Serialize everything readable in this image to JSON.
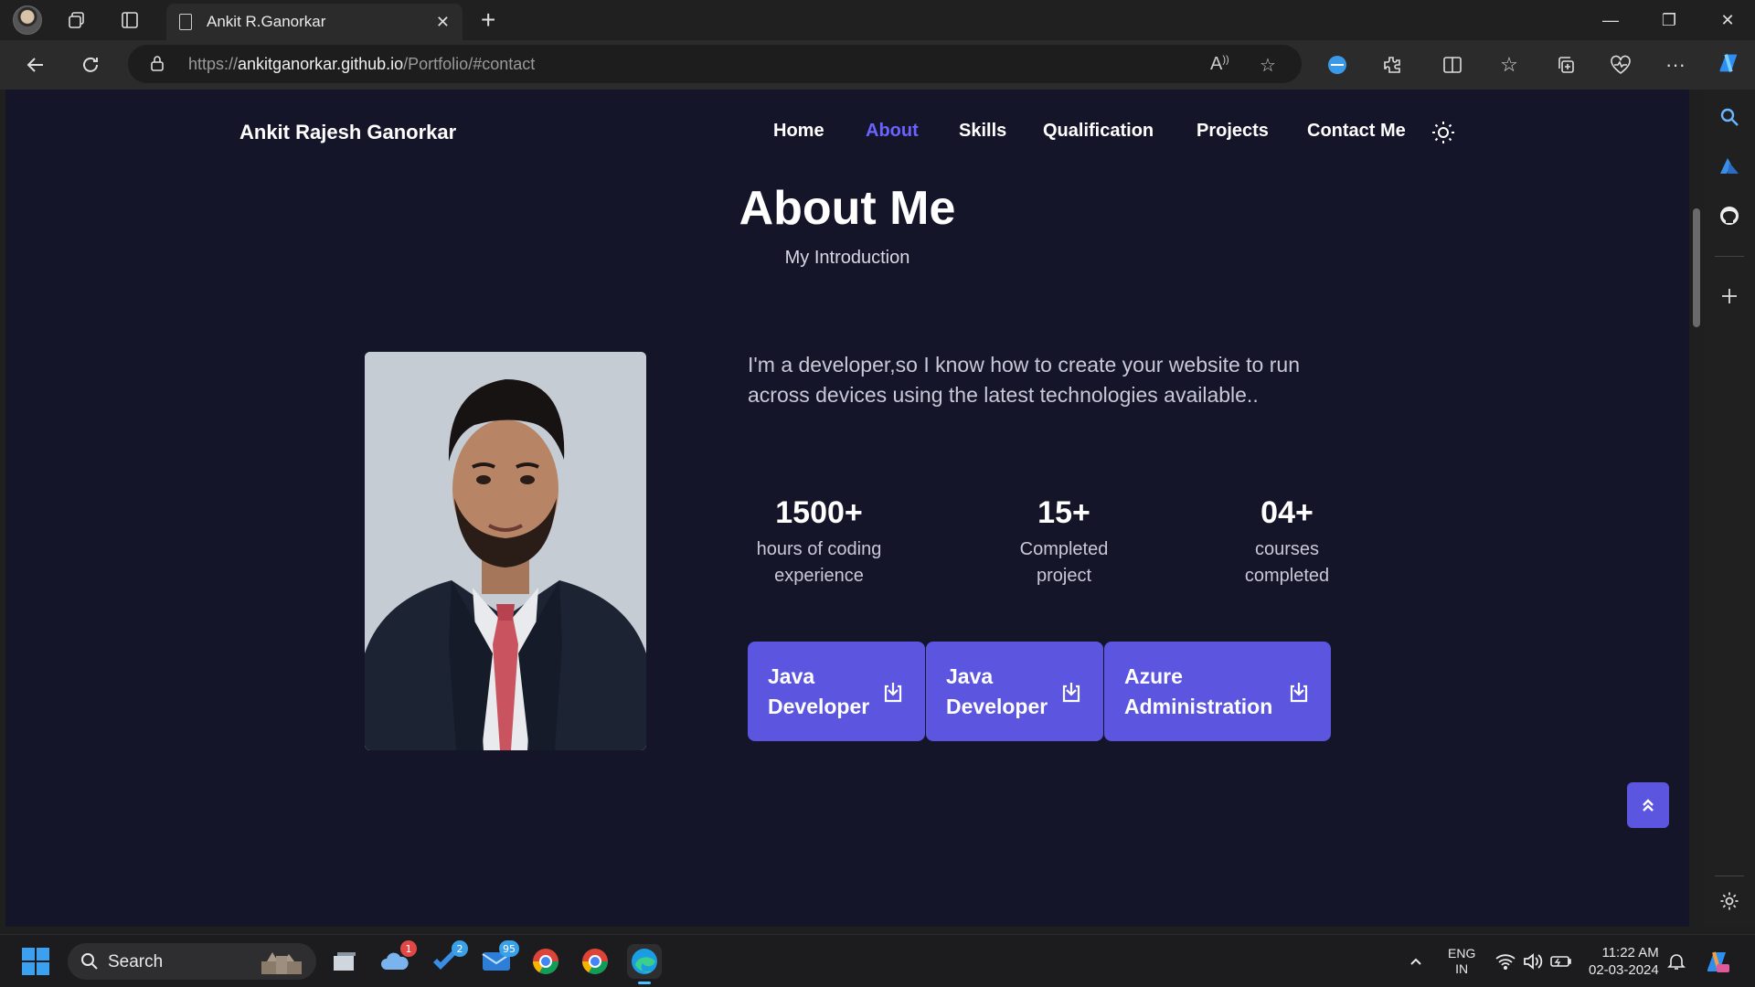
{
  "browser": {
    "tab_title": "Ankit R.Ganorkar",
    "url_prefix": "https://",
    "url_domain": "ankitganorkar.github.io",
    "url_path": "/Portfolio/#contact",
    "new_tab_symbol": "+",
    "close_tab_symbol": "✕",
    "window_controls": {
      "minimize": "—",
      "restore": "❐",
      "close": "✕"
    },
    "toolbar_icons": [
      "read-aloud-icon",
      "favorite-star-icon",
      "vpn-icon",
      "extensions-icon",
      "split-screen-icon",
      "favorites-icon",
      "collections-icon",
      "browser-essentials-icon",
      "more-icon",
      "copilot-icon"
    ],
    "sidebar_icons": [
      "search-icon",
      "azure-icon",
      "github-icon",
      "add-icon",
      "settings-icon"
    ]
  },
  "site": {
    "brand": "Ankit Rajesh Ganorkar",
    "nav": {
      "home": "Home",
      "about": "About",
      "skills": "Skills",
      "qualification": "Qualification",
      "projects": "Projects",
      "contact": "Contact Me"
    },
    "active_nav": "About",
    "accent_color": "#5b55e0",
    "background_color": "#15152a"
  },
  "about": {
    "title": "About Me",
    "subtitle": "My Introduction",
    "description": "I'm a developer,so I know how to create your website to run across devices using the latest technologies available..",
    "stats": [
      {
        "number": "1500+",
        "label_line1": "hours of coding",
        "label_line2": "experience"
      },
      {
        "number": "15+",
        "label_line1": "Completed",
        "label_line2": "project"
      },
      {
        "number": "04+",
        "label_line1": "courses",
        "label_line2": "completed"
      }
    ],
    "download_buttons": [
      {
        "line1": "Java",
        "line2": "Developer"
      },
      {
        "line1": "Java",
        "line2": "Developer"
      },
      {
        "line1": "Azure",
        "line2": "Administration"
      }
    ]
  },
  "taskbar": {
    "search_label": "Search",
    "badges": {
      "cloud": "1",
      "todo": "2",
      "mail": "95"
    },
    "language": "ENG",
    "region": "IN",
    "time": "11:22 AM",
    "date": "02-03-2024"
  }
}
